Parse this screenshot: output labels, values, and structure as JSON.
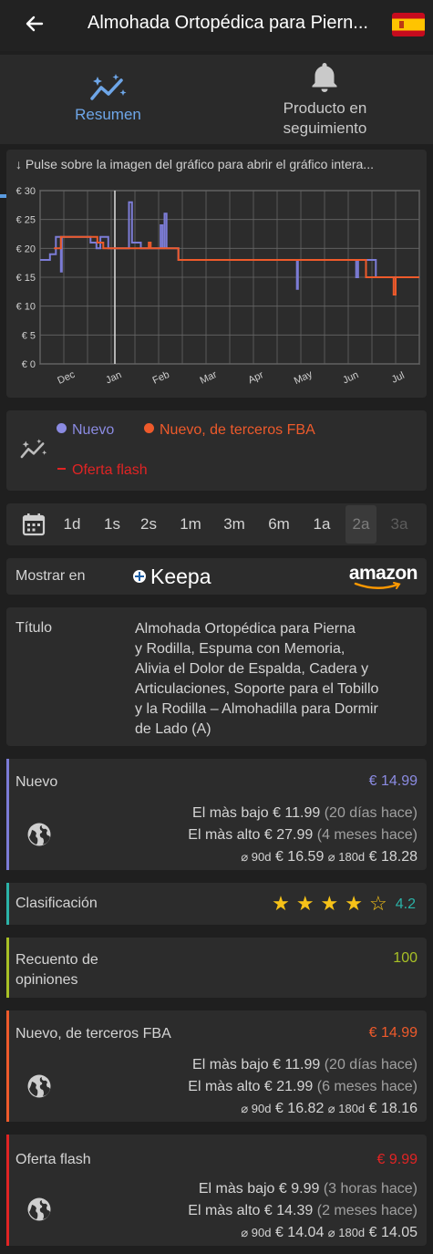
{
  "header": {
    "title": "Almohada Ortopédica para Piern...",
    "back_icon": "arrow-left-icon",
    "flag_icon": "spain-flag-icon"
  },
  "tabs": [
    {
      "label": "Resumen",
      "icon": "chart-sparkle-icon",
      "active": true
    },
    {
      "label": "Producto en seguimiento",
      "icon": "bell-icon",
      "active": false
    }
  ],
  "chart_hint": "↓ Pulse sobre la imagen del gráfico para abrir el gráfico intera...",
  "chart_data": {
    "type": "line",
    "y_tick_labels": [
      "€ 30",
      "€ 25",
      "€ 20",
      "€ 15",
      "€ 10",
      "€ 5",
      "€ 0"
    ],
    "x_tick_labels": [
      "Dec",
      "Jan",
      "Feb",
      "Mar",
      "Apr",
      "May",
      "Jun",
      "Jul"
    ],
    "ylim": [
      0,
      30
    ],
    "grid": true,
    "series": [
      {
        "name": "Nuevo",
        "color": "#7c7cd6",
        "points": [
          [
            0.0,
            18
          ],
          [
            0.5,
            18
          ],
          [
            0.5,
            19
          ],
          [
            0.8,
            19
          ],
          [
            0.8,
            22
          ],
          [
            1.05,
            22
          ],
          [
            1.05,
            16
          ],
          [
            1.1,
            16
          ],
          [
            1.1,
            22
          ],
          [
            1.45,
            22
          ],
          [
            2.55,
            22
          ],
          [
            2.55,
            21
          ],
          [
            2.85,
            21
          ],
          [
            2.85,
            20
          ],
          [
            3.05,
            20
          ],
          [
            3.05,
            22
          ],
          [
            3.45,
            22
          ],
          [
            3.45,
            20
          ],
          [
            4.5,
            20
          ],
          [
            4.5,
            28
          ],
          [
            4.65,
            28
          ],
          [
            4.65,
            21
          ],
          [
            5.1,
            21
          ],
          [
            5.1,
            20
          ],
          [
            6.1,
            20
          ],
          [
            6.1,
            24
          ],
          [
            6.2,
            24
          ],
          [
            6.2,
            20
          ],
          [
            6.3,
            20
          ],
          [
            6.3,
            26
          ],
          [
            6.4,
            26
          ],
          [
            6.4,
            20
          ],
          [
            7.0,
            20
          ],
          [
            7.0,
            18
          ],
          [
            13.0,
            18
          ],
          [
            13.0,
            13
          ],
          [
            13.05,
            13
          ],
          [
            13.05,
            18
          ],
          [
            16.0,
            18
          ],
          [
            16.0,
            15
          ],
          [
            16.1,
            15
          ],
          [
            16.1,
            18
          ],
          [
            17.0,
            18
          ],
          [
            17.0,
            15
          ],
          [
            19.2,
            15
          ]
        ]
      },
      {
        "name": "Nuevo, de terceros FBA",
        "color": "#ee5a2b",
        "points": [
          [
            0.7,
            20
          ],
          [
            1.05,
            20
          ],
          [
            1.05,
            22
          ],
          [
            1.6,
            22
          ],
          [
            2.9,
            22
          ],
          [
            2.9,
            21
          ],
          [
            3.2,
            21
          ],
          [
            3.2,
            20
          ],
          [
            5.0,
            20
          ],
          [
            5.5,
            20
          ],
          [
            5.5,
            21
          ],
          [
            5.6,
            21
          ],
          [
            5.6,
            20
          ],
          [
            7.0,
            20
          ],
          [
            7.0,
            18
          ],
          [
            16.5,
            18
          ],
          [
            16.5,
            15
          ],
          [
            17.9,
            15
          ],
          [
            17.9,
            12
          ],
          [
            18.0,
            12
          ],
          [
            18.0,
            15
          ],
          [
            19.2,
            15
          ]
        ]
      }
    ],
    "legend": [
      {
        "label": "Nuevo",
        "color": "#7c7cd6",
        "marker": "dot"
      },
      {
        "label": "Nuevo, de terceros FBA",
        "color": "#ee5a2b",
        "marker": "dot"
      },
      {
        "label": "Oferta flash",
        "color": "#e02424",
        "marker": "dash"
      }
    ]
  },
  "legend_icon": "chart-sparkle-icon",
  "time_ranges": {
    "icon": "calendar-icon",
    "items": [
      "1d",
      "1s",
      "2s",
      "1m",
      "3m",
      "6m",
      "1a",
      "2a",
      "3a"
    ],
    "selected": "2a",
    "disabled": [
      "3a"
    ]
  },
  "show_in": {
    "label": "Mostrar en",
    "keepa": "Keepa",
    "amazon": "amazon"
  },
  "product": {
    "title_label": "Título",
    "title_lines": [
      "Almohada Ortopédica para Pierna",
      "y Rodilla, Espuma con Memoria,",
      "Alivia el Dolor de Espalda, Cadera y",
      "Articulaciones, Soporte para el Tobillo",
      "y la Rodilla – Almohadilla para Dormir",
      "de Lado (A)"
    ]
  },
  "nuevo": {
    "label": "Nuevo",
    "price": "€ 14.99",
    "accent": "#7c7cd6",
    "low_label": "El màs bajo",
    "low": "€ 11.99",
    "low_when": "(20 días hace)",
    "high_label": "El màs alto",
    "high": "€ 27.99",
    "high_when": "(4 meses hace)",
    "avg90_label": "⌀ 90d",
    "avg90": "€ 16.59",
    "avg180_label": "⌀ 180d",
    "avg180": "€ 18.28"
  },
  "rating": {
    "label": "Clasificación",
    "value": "4.2",
    "stars": 4,
    "accent": "#2bb3a8"
  },
  "reviews": {
    "label_line1": "Recuento de",
    "label_line2": "opiniones",
    "value": "100",
    "accent": "#a8c026"
  },
  "fba": {
    "label": "Nuevo, de terceros FBA",
    "price": "€ 14.99",
    "accent": "#ee5a2b",
    "low_label": "El màs bajo",
    "low": "€ 11.99",
    "low_when": "(20 días hace)",
    "high_label": "El màs alto",
    "high": "€ 21.99",
    "high_when": "(6 meses hace)",
    "avg90_label": "⌀ 90d",
    "avg90": "€ 16.82",
    "avg180_label": "⌀ 180d",
    "avg180": "€ 18.16"
  },
  "flash": {
    "label": "Oferta flash",
    "price": "€ 9.99",
    "accent": "#e02424",
    "low_label": "El màs bajo",
    "low": "€ 9.99",
    "low_when": "(3 horas hace)",
    "high_label": "El màs alto",
    "high": "€ 14.39",
    "high_when": "(2 meses hace)",
    "avg90_label": "⌀ 90d",
    "avg90": "€ 14.04",
    "avg180_label": "⌀ 180d",
    "avg180": "€ 14.05"
  },
  "globe_icon": "globe-icon"
}
